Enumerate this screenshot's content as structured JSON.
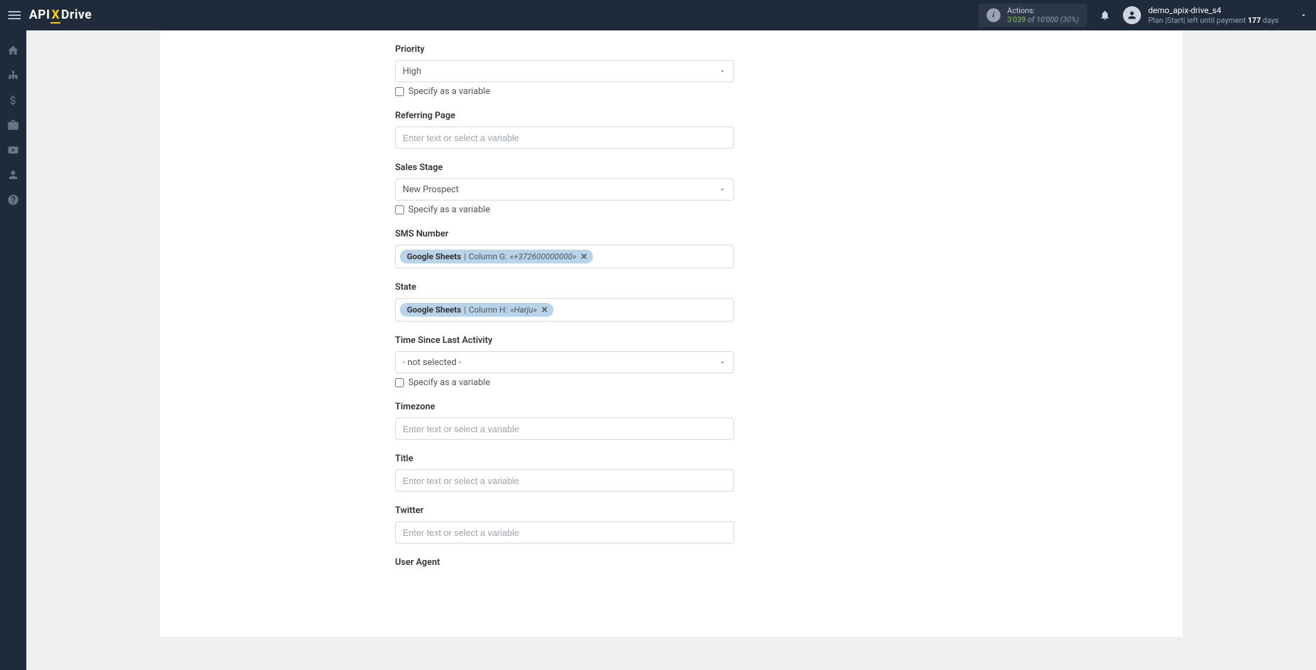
{
  "header": {
    "logo": {
      "part1": "API",
      "part2": "X",
      "part3": "Drive"
    },
    "actions": {
      "label": "Actions:",
      "count": "3'039",
      "of": "of",
      "total": "10'000",
      "pct": "(30%)"
    },
    "user": {
      "name": "demo_apix-drive_s4",
      "plan_prefix": "Plan |Start| left until payment",
      "days_count": "177",
      "days_suffix": "days"
    }
  },
  "form": {
    "priority": {
      "label": "Priority",
      "value": "High",
      "checkbox": "Specify as a variable"
    },
    "referring_page": {
      "label": "Referring Page",
      "placeholder": "Enter text or select a variable"
    },
    "sales_stage": {
      "label": "Sales Stage",
      "value": "New Prospect",
      "checkbox": "Specify as a variable"
    },
    "sms_number": {
      "label": "SMS Number",
      "tag": {
        "source": "Google Sheets",
        "sep": " | ",
        "column": "Column G: ",
        "value": "«+372600000000»"
      }
    },
    "state": {
      "label": "State",
      "tag": {
        "source": "Google Sheets",
        "sep": " | ",
        "column": "Column H: ",
        "value": "«Harju»"
      }
    },
    "time_since": {
      "label": "Time Since Last Activity",
      "value": "- not selected -",
      "checkbox": "Specify as a variable"
    },
    "timezone": {
      "label": "Timezone",
      "placeholder": "Enter text or select a variable"
    },
    "title": {
      "label": "Title",
      "placeholder": "Enter text or select a variable"
    },
    "twitter": {
      "label": "Twitter",
      "placeholder": "Enter text or select a variable"
    },
    "user_agent": {
      "label": "User Agent"
    }
  }
}
